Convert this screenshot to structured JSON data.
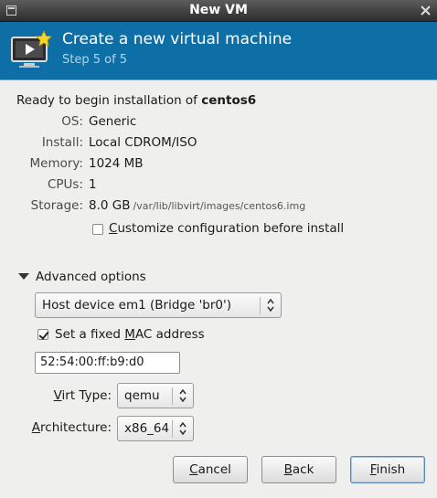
{
  "window": {
    "title": "New VM",
    "menu_icon": "window-menu-icon",
    "close_icon": "close-icon"
  },
  "header": {
    "icon": "new-vm-icon",
    "title": "Create a new virtual machine",
    "step": "Step 5 of 5",
    "colors": {
      "background": "#0d6fa6",
      "step_text": "#aed6f0"
    }
  },
  "summary": {
    "ready_prefix": "Ready to begin installation of ",
    "vm_name": "centos6",
    "rows": [
      {
        "label": "OS:",
        "value": "Generic"
      },
      {
        "label": "Install:",
        "value": "Local CDROM/ISO"
      },
      {
        "label": "Memory:",
        "value": "1024 MB"
      },
      {
        "label": "CPUs:",
        "value": "1"
      },
      {
        "label": "Storage:",
        "value": "8.0 GB",
        "path": "/var/lib/libvirt/images/centos6.img"
      }
    ],
    "customize": {
      "label_prefix": "",
      "label_mnemonic": "C",
      "label_rest": "ustomize configuration before install",
      "checked": false
    }
  },
  "advanced": {
    "label": "Advanced options",
    "expanded": true,
    "network": {
      "selected": "Host device em1 (Bridge 'br0')"
    },
    "fixed_mac": {
      "label_prefix": "Set a fixed ",
      "label_mnemonic": "M",
      "label_rest": "AC address",
      "checked": true
    },
    "mac_address": "52:54:00:ff:b9:d0",
    "virt_type": {
      "label_prefix": "",
      "label_mnemonic": "V",
      "label_rest": "irt Type:",
      "selected": "qemu"
    },
    "architecture": {
      "label_prefix": "",
      "label_mnemonic": "A",
      "label_rest": "rchitecture:",
      "selected": "x86_64"
    }
  },
  "buttons": {
    "cancel": {
      "mnemonic": "C",
      "rest": "ancel"
    },
    "back": {
      "mnemonic": "B",
      "rest": "ack"
    },
    "finish": {
      "mnemonic": "F",
      "rest": "inish"
    }
  }
}
